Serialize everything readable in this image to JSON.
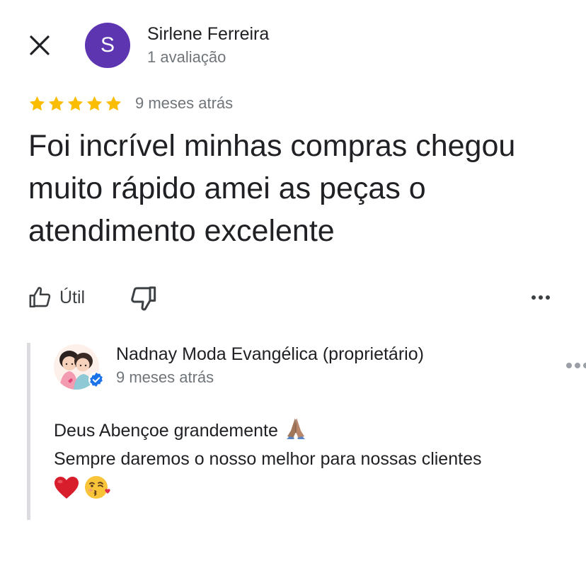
{
  "header": {
    "close_icon": "close-icon",
    "avatar_letter": "S",
    "avatar_color": "#5e35b1",
    "reviewer_name": "Sirlene Ferreira",
    "reviewer_meta": "1 avaliação"
  },
  "review": {
    "rating": 5,
    "rating_max": 5,
    "star_color": "#fbbc04",
    "time": "9 meses atrás",
    "text": "Foi incrível minhas compras chegou muito rápido amei as peças o atendimento excelente"
  },
  "actions": {
    "useful_label": "Útil",
    "useful_icon": "thumb-up-icon",
    "dislike_icon": "thumb-down-icon",
    "more_icon": "more-horizontal-icon"
  },
  "owner_reply": {
    "name": "Nadnay Moda Evangélica (proprietário)",
    "time": "9 meses atrás",
    "verified_color": "#1a73e8",
    "line1": "Deus Abençoe grandemente",
    "line1_emoji": "folded-hands-emoji",
    "line2": "Sempre daremos o nosso melhor para nossas clientes",
    "line3_emojis": [
      "red-heart-emoji",
      "face-blowing-kiss-emoji"
    ]
  }
}
